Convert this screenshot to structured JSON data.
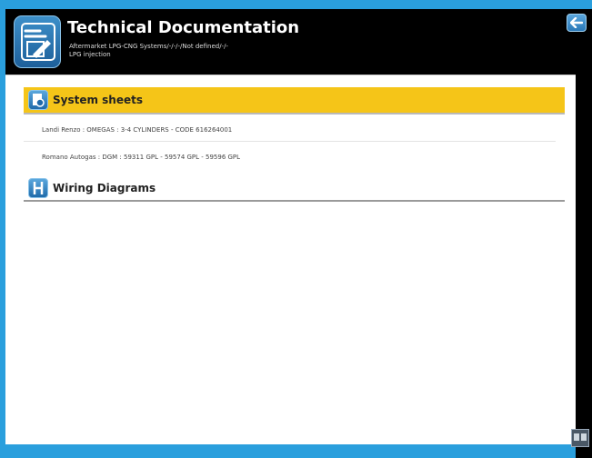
{
  "header": {
    "title": "Technical Documentation",
    "subtitle_line1": "Aftermarket LPG-CNG Systems/-/-/-/Not defined/-/-",
    "subtitle_line2": "LPG injection"
  },
  "sections": {
    "system_sheets": {
      "label": "System sheets",
      "items": [
        "Landi Renzo : OMEGAS : 3-4 CYLINDERS - CODE 616264001",
        "Romano Autogas : DGM : 59311 GPL - 59574 GPL - 59596 GPL"
      ]
    },
    "wiring_diagrams": {
      "label": "Wiring Diagrams"
    }
  },
  "icons": {
    "app": "tools-document-icon",
    "back": "arrow-left-icon",
    "system_sheets": "document-gear-icon",
    "wiring": "wiring-diagram-icon",
    "corner": "gallery-icon"
  },
  "colors": {
    "background": "#2a9fdd",
    "header": "#000000",
    "section_highlight": "#f5c518"
  }
}
